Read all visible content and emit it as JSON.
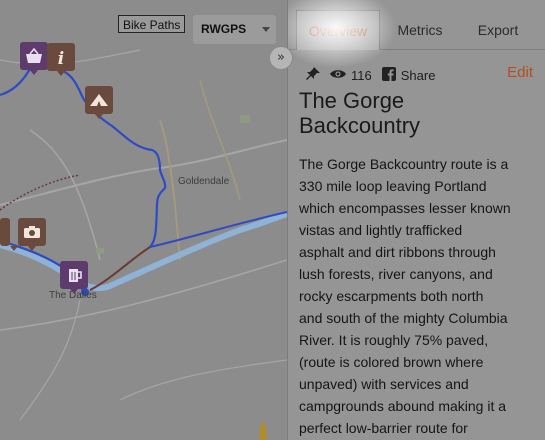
{
  "map": {
    "bike_paths_label": "Bike Paths",
    "map_type_select": "RWGPS",
    "collapse_label": "»",
    "place_goldendale": "Goldendale",
    "place_the_dalles": "The Dalles",
    "colors": {
      "route_paved": "#2f4bc4",
      "route_unpaved": "#6b3a3a",
      "columbia_river": "#8fb3d6"
    },
    "markers": [
      "shopping-basket-icon",
      "info-icon",
      "campground-icon",
      "camera-icon",
      "beer-icon"
    ]
  },
  "panel": {
    "tabs": [
      "Overview",
      "Metrics",
      "Export"
    ],
    "active_tab": "Overview",
    "view_count": "116",
    "share_label": "Share",
    "edit_label": "Edit",
    "title_lines": [
      "The Gorge",
      "Backcountry"
    ],
    "description_lines": [
      "The Gorge Backcountry route is a",
      "330 mile loop leaving Portland",
      "which encompasses lesser known",
      "vistas and lightly trafficked",
      "asphalt and dirt ribbons through",
      "lush forests, river canyons, and",
      "rocky escarpments both north",
      "and south of the mighty Columbia",
      "River. It is roughly 75% paved,",
      "(route is colored brown where",
      "unpaved) with services and",
      "campgrounds abound making it a",
      "perfect low-barrier route for"
    ],
    "accent_color": "#b54e1e"
  }
}
